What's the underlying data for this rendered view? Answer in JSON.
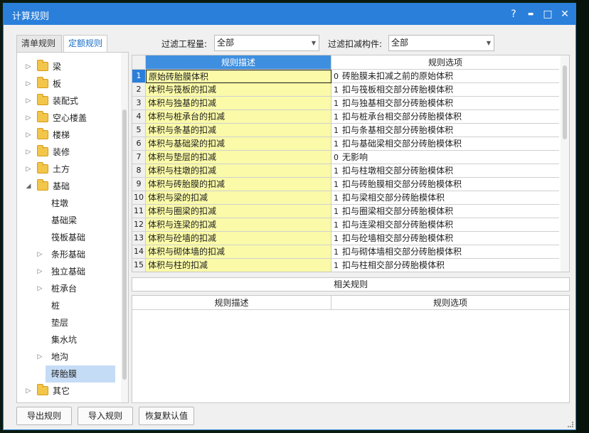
{
  "window": {
    "title": "计算规则",
    "controls": {
      "help": "?",
      "minimize": "▬",
      "maximize": "□",
      "close": "✕"
    }
  },
  "tabs": [
    {
      "label": "清单规则",
      "active": false
    },
    {
      "label": "定额规则",
      "active": true
    }
  ],
  "tree": {
    "items": [
      {
        "label": "梁",
        "arrow": "▷",
        "folder": true,
        "level": 0
      },
      {
        "label": "板",
        "arrow": "▷",
        "folder": true,
        "level": 0
      },
      {
        "label": "装配式",
        "arrow": "▷",
        "folder": true,
        "level": 0
      },
      {
        "label": "空心楼盖",
        "arrow": "▷",
        "folder": true,
        "level": 0
      },
      {
        "label": "楼梯",
        "arrow": "▷",
        "folder": true,
        "level": 0
      },
      {
        "label": "装修",
        "arrow": "▷",
        "folder": true,
        "level": 0
      },
      {
        "label": "土方",
        "arrow": "▷",
        "folder": true,
        "level": 0
      },
      {
        "label": "基础",
        "arrow": "◢",
        "folder": true,
        "level": 0
      },
      {
        "label": "柱墩",
        "arrow": "",
        "folder": false,
        "level": 1
      },
      {
        "label": "基础梁",
        "arrow": "",
        "folder": false,
        "level": 1
      },
      {
        "label": "筏板基础",
        "arrow": "",
        "folder": false,
        "level": 1
      },
      {
        "label": "条形基础",
        "arrow": "▷",
        "folder": false,
        "level": 1
      },
      {
        "label": "独立基础",
        "arrow": "▷",
        "folder": false,
        "level": 1
      },
      {
        "label": "桩承台",
        "arrow": "▷",
        "folder": false,
        "level": 1
      },
      {
        "label": "桩",
        "arrow": "",
        "folder": false,
        "level": 1
      },
      {
        "label": "垫层",
        "arrow": "",
        "folder": false,
        "level": 1
      },
      {
        "label": "集水坑",
        "arrow": "",
        "folder": false,
        "level": 1
      },
      {
        "label": "地沟",
        "arrow": "▷",
        "folder": false,
        "level": 1
      },
      {
        "label": "砖胎膜",
        "arrow": "",
        "folder": false,
        "level": 1,
        "selected": true
      },
      {
        "label": "其它",
        "arrow": "▷",
        "folder": true,
        "level": 0
      }
    ]
  },
  "filters": {
    "quantity_label": "过滤工程量:",
    "quantity_value": "全部",
    "deduct_label": "过滤扣减构件:",
    "deduct_value": "全部"
  },
  "grid": {
    "headers": {
      "desc": "规则描述",
      "option": "规则选项"
    },
    "rows": [
      {
        "idx": "1",
        "desc": "原始砖胎膜体积",
        "code": "0",
        "option": "砖胎膜未扣减之前的原始体积"
      },
      {
        "idx": "2",
        "desc": "体积与筏板的扣减",
        "code": "1",
        "option": "扣与筏板相交部分砖胎模体积"
      },
      {
        "idx": "3",
        "desc": "体积与独基的扣减",
        "code": "1",
        "option": "扣与独基相交部分砖胎模体积"
      },
      {
        "idx": "4",
        "desc": "体积与桩承台的扣减",
        "code": "1",
        "option": "扣与桩承台相交部分砖胎模体积"
      },
      {
        "idx": "5",
        "desc": "体积与条基的扣减",
        "code": "1",
        "option": "扣与条基相交部分砖胎模体积"
      },
      {
        "idx": "6",
        "desc": "体积与基础梁的扣减",
        "code": "1",
        "option": "扣与基础梁相交部分砖胎模体积"
      },
      {
        "idx": "7",
        "desc": "体积与垫层的扣减",
        "code": "0",
        "option": "无影响"
      },
      {
        "idx": "8",
        "desc": "体积与柱墩的扣减",
        "code": "1",
        "option": "扣与柱墩相交部分砖胎模体积"
      },
      {
        "idx": "9",
        "desc": "体积与砖胎膜的扣减",
        "code": "1",
        "option": "扣与砖胎膜相交部分砖胎模体积"
      },
      {
        "idx": "10",
        "desc": "体积与梁的扣减",
        "code": "1",
        "option": "扣与梁相交部分砖胎模体积"
      },
      {
        "idx": "11",
        "desc": "体积与圈梁的扣减",
        "code": "1",
        "option": "扣与圈梁相交部分砖胎模体积"
      },
      {
        "idx": "12",
        "desc": "体积与连梁的扣减",
        "code": "1",
        "option": "扣与连梁相交部分砖胎模体积"
      },
      {
        "idx": "13",
        "desc": "体积与砼墙的扣减",
        "code": "1",
        "option": "扣与砼墙相交部分砖胎模体积"
      },
      {
        "idx": "14",
        "desc": "体积与砌体墙的扣减",
        "code": "1",
        "option": "扣与砌体墙相交部分砖胎模体积"
      },
      {
        "idx": "15",
        "desc": "体积与柱的扣减",
        "code": "1",
        "option": "扣与柱相交部分砖胎模体积"
      }
    ]
  },
  "related": {
    "title": "相关规则",
    "headers": {
      "desc": "规则描述",
      "option": "规则选项"
    }
  },
  "buttons": {
    "export": "导出规则",
    "import": "导入规则",
    "restore": "恢复默认值"
  },
  "colors": {
    "titlebar": "#2a7fdb",
    "desc_header": "#3f8fe0",
    "desc_cell": "#fafaa8",
    "selection": "#c5dcf6"
  }
}
